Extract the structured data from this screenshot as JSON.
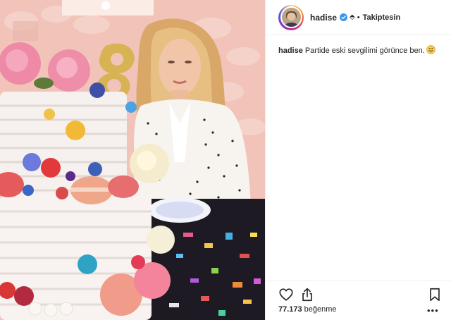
{
  "header": {
    "username": "hadise",
    "follow_label": "Takiptesin",
    "separator": "•"
  },
  "caption": {
    "username": "hadise",
    "text": "Partide eski sevgilimi görünce ben."
  },
  "likes": {
    "count": "77.173",
    "label": "beğenme"
  },
  "icons": {
    "like": "heart-icon",
    "share": "share-icon",
    "save": "bookmark-icon",
    "more": "more-dots-icon",
    "verified": "verified-badge-icon",
    "emoji": "grinning-sweat-emoji"
  },
  "colors": {
    "verified_blue": "#3897f0",
    "text": "#262626",
    "divider": "#efefef"
  }
}
